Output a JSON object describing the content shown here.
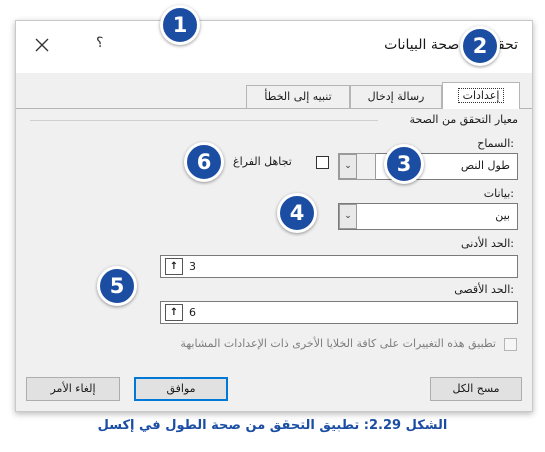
{
  "dialog": {
    "title": "تحقق من صحة البيانات",
    "help_label": "؟",
    "close_label": "✕"
  },
  "tabs": [
    {
      "label": "إعدادات"
    },
    {
      "label": "رسالة إدخال"
    },
    {
      "label": "تنبيه إلى الخطأ"
    }
  ],
  "settings": {
    "section_title": "معيار التحقق من الصحة",
    "allow_label": "السماح:",
    "allow_value": "طول النص",
    "ignore_blank_label": "تجاهل الفراغ",
    "data_label": "بيانات:",
    "data_value": "بين",
    "min_label": "الحد الأدنى:",
    "min_value": "3",
    "max_label": "الحد الأقصى:",
    "max_value": "6",
    "apply_label": "تطبيق هذه التغييرات على كافة الخلايا الأخرى ذات الإعدادات المشابهة"
  },
  "footer": {
    "clear_all": "مسح الكل",
    "ok": "موافق",
    "cancel": "إلغاء الأمر"
  },
  "callouts": [
    "1",
    "2",
    "3",
    "4",
    "5",
    "6"
  ],
  "caption": "الشكل 2.29: تطبيق التحقق من صحة الطول في إكسل",
  "colors": {
    "badge": "#1b4ea3",
    "caption": "#1b4ea3",
    "default_button_border": "#0078d7"
  }
}
